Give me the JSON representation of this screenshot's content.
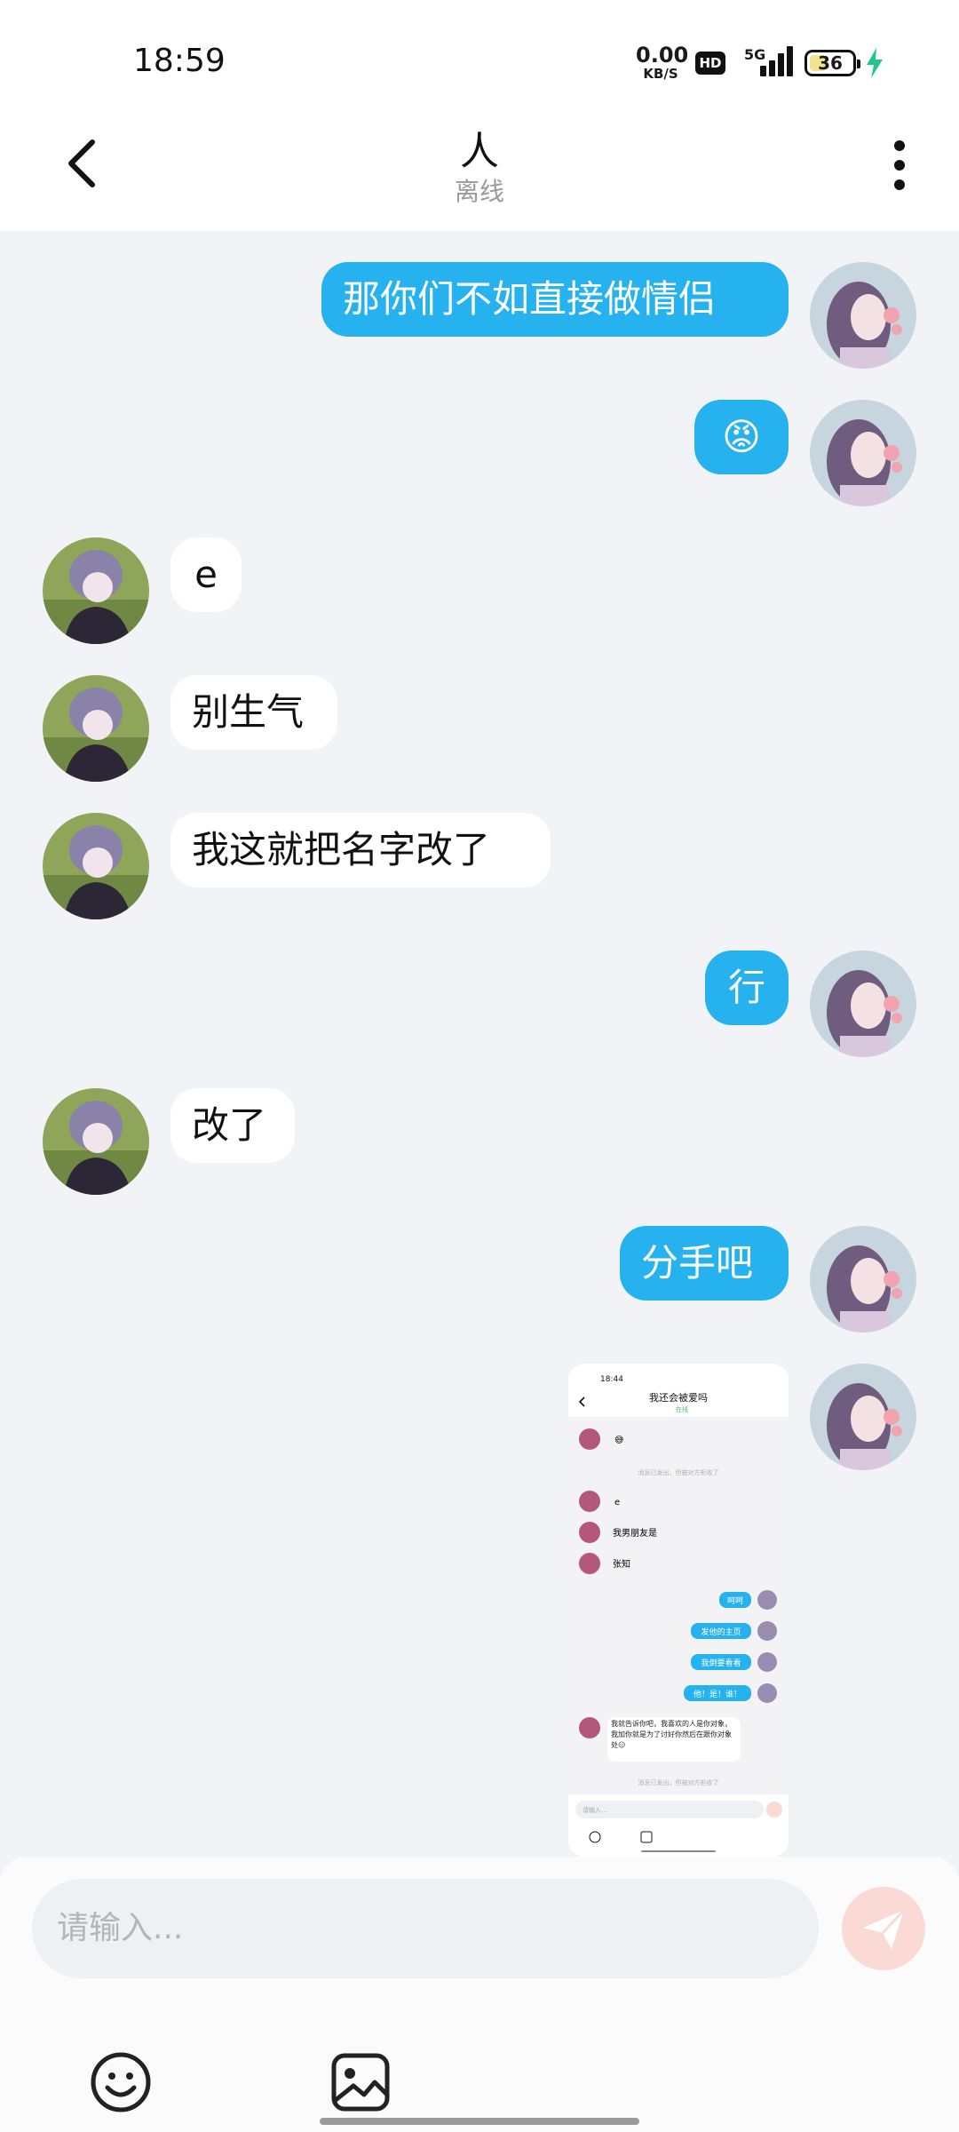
{
  "status_bar": {
    "time": "18:59",
    "net_speed": "0.00",
    "net_unit": "KB/S",
    "hd_badge": "HD",
    "signal_label": "5G",
    "battery": "36"
  },
  "header": {
    "title": "人",
    "subtitle": "离线"
  },
  "messages": [
    {
      "from": "me",
      "text": "那你们不如直接做情侣"
    },
    {
      "from": "me",
      "text": "😡"
    },
    {
      "from": "them",
      "text": "e"
    },
    {
      "from": "them",
      "text": "别生气"
    },
    {
      "from": "them",
      "text": "我这就把名字改了"
    },
    {
      "from": "me",
      "text": "行"
    },
    {
      "from": "them",
      "text": "改了"
    },
    {
      "from": "me",
      "text": "分手吧"
    },
    {
      "from": "me",
      "type": "image"
    }
  ],
  "screenshot_image": {
    "time": "18:44",
    "title": "我还会被爱吗",
    "status": "在线",
    "system_note": "消息已发出，但被对方拒收了",
    "input_placeholder": "请输入...",
    "messages": [
      {
        "from": "them",
        "text": "😅"
      },
      {
        "from": "them",
        "text": "e"
      },
      {
        "from": "them",
        "text": "我男朋友是"
      },
      {
        "from": "them",
        "text": "张知"
      },
      {
        "from": "me",
        "text": "呵呵"
      },
      {
        "from": "me",
        "text": "发他的主页"
      },
      {
        "from": "me",
        "text": "我倒要看看"
      },
      {
        "from": "me",
        "text": "他！是！谁！"
      },
      {
        "from": "them",
        "text": "我就告诉你吧，我喜欢的人是你对象，我加你就是为了讨好你然后在跟你对象处😑"
      }
    ]
  },
  "composer": {
    "placeholder": "请输入..."
  },
  "colors": {
    "accent": "#26b2ee",
    "background": "#f1f3f6",
    "send_button": "#fbdad6"
  }
}
